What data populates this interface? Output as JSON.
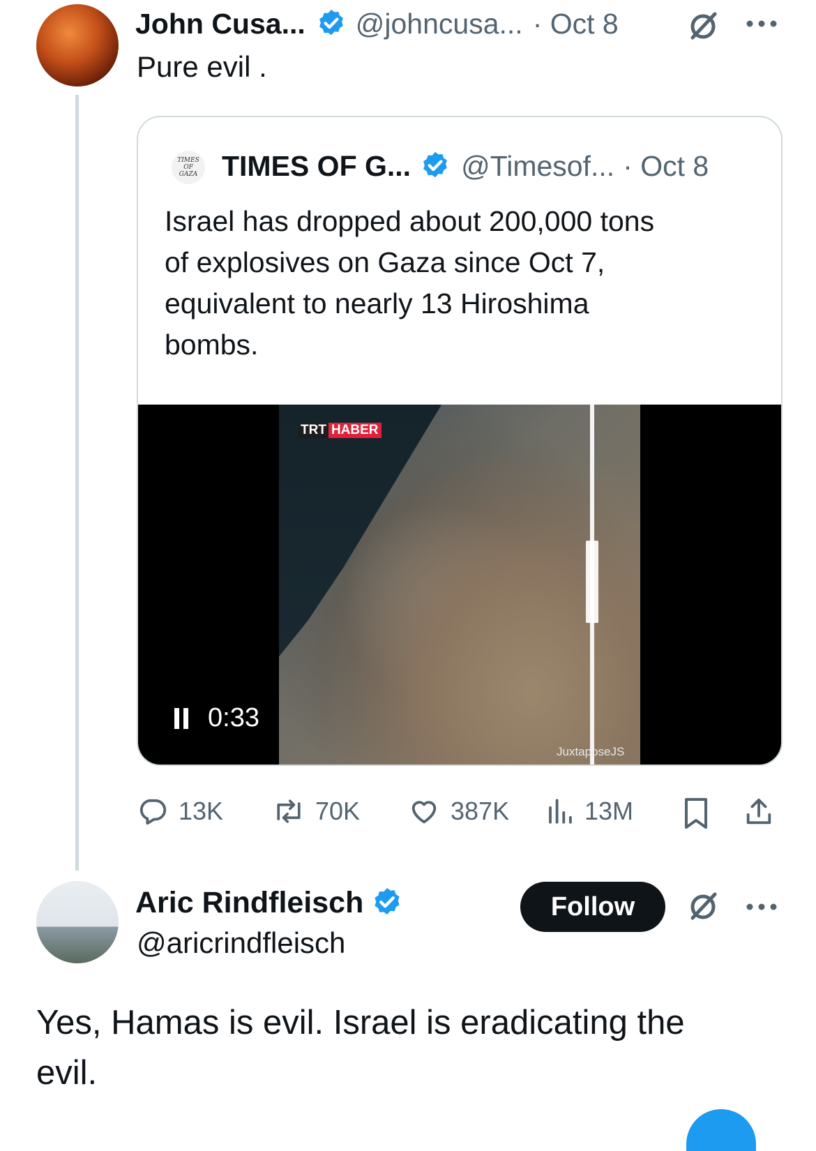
{
  "tweet": {
    "name": "John Cusa...",
    "handle": "@johncusa...",
    "date": "· Oct 8",
    "text": "Pure evil ."
  },
  "quote": {
    "avatar_text": "TIMES OF GAZA",
    "name": "TIMES OF G...",
    "handle": "@Timesof...",
    "date": "· Oct 8",
    "text_lines": [
      "Israel has dropped about 200,000 tons",
      "of explosives on Gaza since Oct 7,",
      "equivalent to nearly 13 Hiroshima",
      "bombs."
    ],
    "video": {
      "channel_part1": "TRT",
      "channel_part2": "HABER",
      "watermark": "JuxtaposeJS",
      "time": "0:33"
    }
  },
  "actions": {
    "replies": "13K",
    "reposts": "70K",
    "likes": "387K",
    "views": "13M"
  },
  "reply": {
    "name": "Aric Rindfleisch",
    "handle": "@aricrindfleisch",
    "follow_label": "Follow",
    "text_lines": [
      "Yes, Hamas is evil. Israel is eradicating the",
      "evil."
    ]
  },
  "colors": {
    "verified": "#1d9bf0",
    "muted": "#536471",
    "border": "#cfd9de",
    "follow_bg": "#0f1419"
  },
  "icons": [
    "verified-badge-icon",
    "grok-icon",
    "more-icon",
    "reply-icon",
    "repost-icon",
    "like-icon",
    "views-icon",
    "bookmark-icon",
    "share-icon",
    "pause-icon"
  ]
}
